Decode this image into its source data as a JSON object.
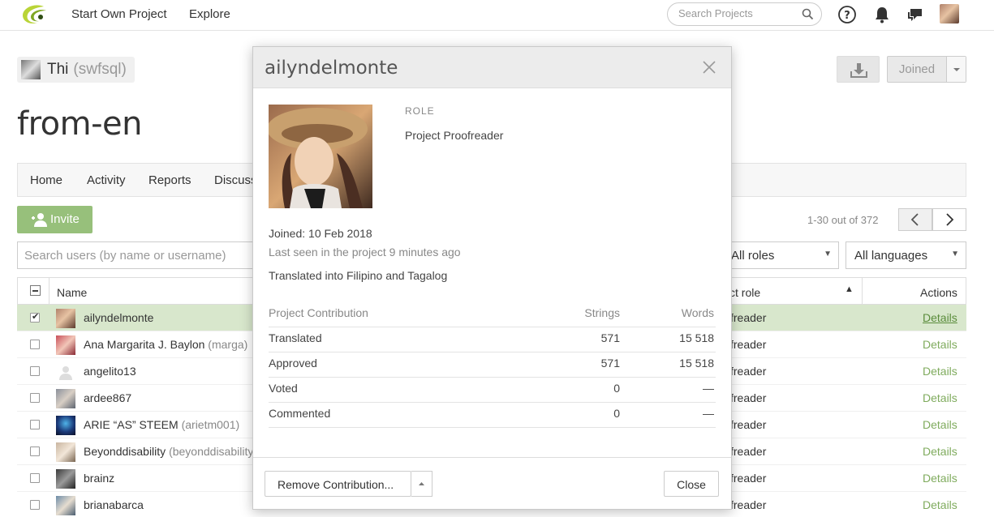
{
  "nav": {
    "start_own_project": "Start Own Project",
    "explore": "Explore",
    "search_placeholder": "Search Projects"
  },
  "project": {
    "owner_name": "Thi",
    "owner_username": "(swfsql)",
    "title": "from-en",
    "joined_label": "Joined"
  },
  "tabs": [
    "Home",
    "Activity",
    "Reports",
    "Discuss"
  ],
  "members": {
    "invite_label": "Invite",
    "pager_text": "1-30 out of 372",
    "search_placeholder": "Search users (by name or username)",
    "roles_filter": "All roles",
    "languages_filter": "All languages",
    "columns": {
      "name": "Name",
      "role": "ct role",
      "actions": "Actions"
    },
    "rows": [
      {
        "name": "ailyndelmonte",
        "username": "",
        "role": "freader",
        "action": "Details",
        "checked": true
      },
      {
        "name": "Ana Margarita J. Baylon",
        "username": "(marga)",
        "role": "freader",
        "action": "Details",
        "checked": false
      },
      {
        "name": "angelito13",
        "username": "",
        "role": "freader",
        "action": "Details",
        "checked": false
      },
      {
        "name": "ardee867",
        "username": "",
        "role": "freader",
        "action": "Details",
        "checked": false
      },
      {
        "name": "ARIE “AS” STEEM",
        "username": "(arietm001)",
        "role": "freader",
        "action": "Details",
        "checked": false
      },
      {
        "name": "Beyonddisability",
        "username": "(beyonddisability)",
        "role": "freader",
        "action": "Details",
        "checked": false
      },
      {
        "name": "brainz",
        "username": "",
        "role": "freader",
        "action": "Details",
        "checked": false
      },
      {
        "name": "brianabarca",
        "username": "",
        "role": "freader",
        "action": "Details",
        "checked": false
      }
    ]
  },
  "modal": {
    "title": "ailyndelmonte",
    "role_caption": "ROLE",
    "role_value": "Project Proofreader",
    "joined": "Joined: 10 Feb 2018",
    "last_seen": "Last seen in the project 9 minutes ago",
    "translated_into": "Translated into Filipino and Tagalog",
    "contribution": {
      "header": {
        "label": "Project Contribution",
        "strings": "Strings",
        "words": "Words"
      },
      "rows": [
        {
          "label": "Translated",
          "strings": "571",
          "words": "15 518"
        },
        {
          "label": "Approved",
          "strings": "571",
          "words": "15 518"
        },
        {
          "label": "Voted",
          "strings": "0",
          "words": "—"
        },
        {
          "label": "Commented",
          "strings": "0",
          "words": "—"
        }
      ]
    },
    "remove_label": "Remove Contribution...",
    "close_label": "Close"
  },
  "colors": {
    "accent_green": "#97c07b",
    "selected_row": "#d8e7cc",
    "details_link": "#7fab5d"
  }
}
